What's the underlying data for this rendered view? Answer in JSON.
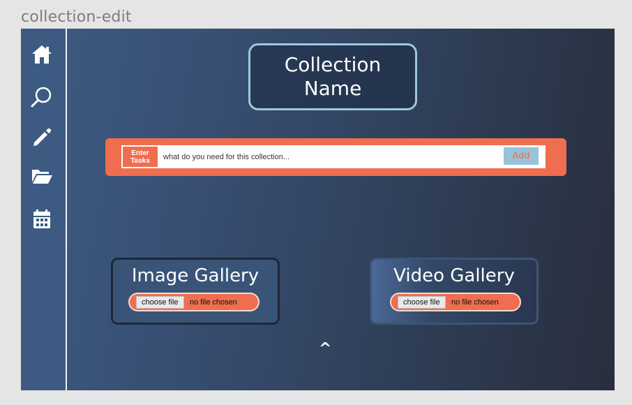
{
  "frame": {
    "label": "collection-edit"
  },
  "sidebar": {
    "items": [
      {
        "icon": "home-icon"
      },
      {
        "icon": "search-icon"
      },
      {
        "icon": "pencil-icon"
      },
      {
        "icon": "folder-open-icon"
      },
      {
        "icon": "calendar-icon"
      }
    ]
  },
  "header": {
    "title": "Collection Name"
  },
  "tasks": {
    "label": "Enter Tasks",
    "placeholder": "what do you need for this collection...",
    "value": "",
    "add_label": "Add"
  },
  "galleries": {
    "image": {
      "title": "Image Gallery",
      "button_label": "choose file",
      "status": "no file chosen"
    },
    "video": {
      "title": "Video Gallery",
      "button_label": "choose file",
      "status": "no file chosen"
    }
  },
  "scroll_up": {
    "label": "^"
  },
  "colors": {
    "accent": "#ee6e4f",
    "sidebar": "#3d5a82",
    "title_border": "#9ec7e0",
    "add_button": "#98c3da"
  }
}
